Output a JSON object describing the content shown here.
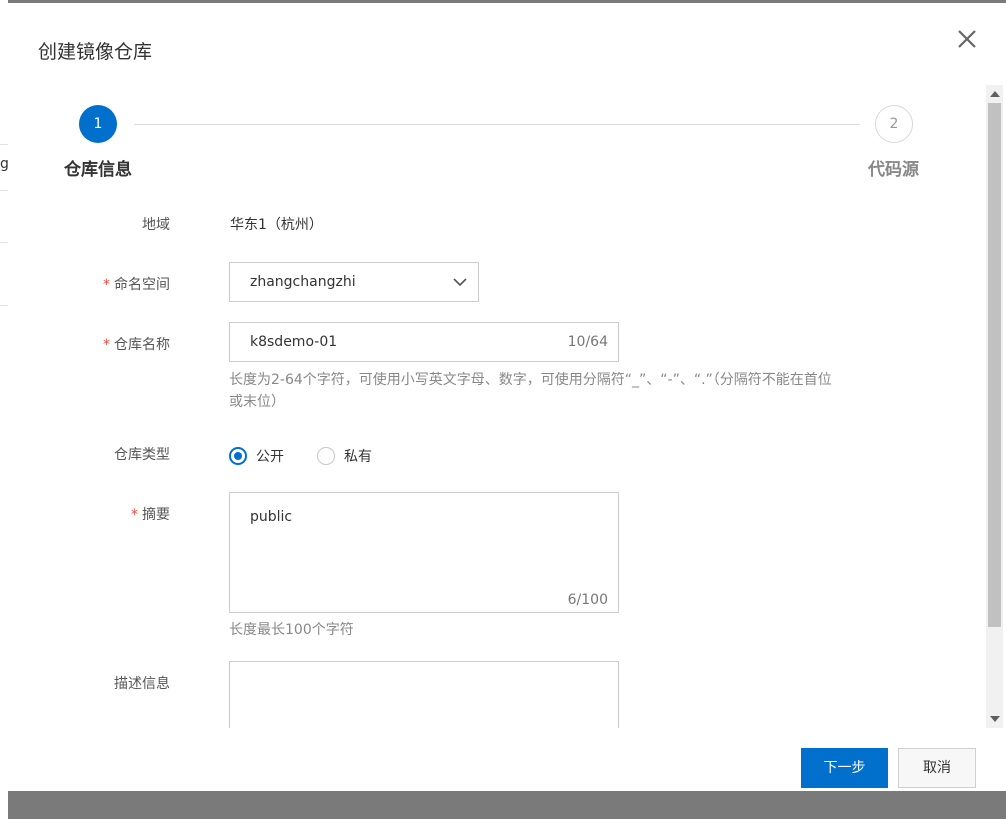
{
  "background_page": {
    "partial_text": "g"
  },
  "dialog": {
    "title": "创建镜像仓库",
    "close_icon": "close-icon"
  },
  "steps": [
    {
      "number": "1",
      "label": "仓库信息",
      "state": "active"
    },
    {
      "number": "2",
      "label": "代码源",
      "state": "pending"
    }
  ],
  "form": {
    "region": {
      "label": "地域",
      "value": "华东1（杭州）"
    },
    "namespace": {
      "required_mark": "*",
      "label": "命名空间",
      "value": "zhangchangzhi"
    },
    "repo_name": {
      "required_mark": "*",
      "label": "仓库名称",
      "value": "k8sdemo-01",
      "counter": "10/64",
      "hint_line1": "长度为2-64个字符，可使用小写英文字母、数字，可使用分隔符“_”、“-”、“.”（分隔符不能在首位",
      "hint_line2": "或末位）"
    },
    "repo_type": {
      "label": "仓库类型",
      "options": [
        {
          "label": "公开",
          "checked": true
        },
        {
          "label": "私有",
          "checked": false
        }
      ]
    },
    "summary": {
      "required_mark": "*",
      "label": "摘要",
      "value": "public",
      "counter": "6/100",
      "hint": "长度最长100个字符"
    },
    "description": {
      "label": "描述信息",
      "value": ""
    }
  },
  "footer": {
    "next_label": "下一步",
    "cancel_label": "取消"
  },
  "colors": {
    "primary": "#0070cc",
    "required": "#e84b3c",
    "overlay": "#7a7a7a"
  }
}
